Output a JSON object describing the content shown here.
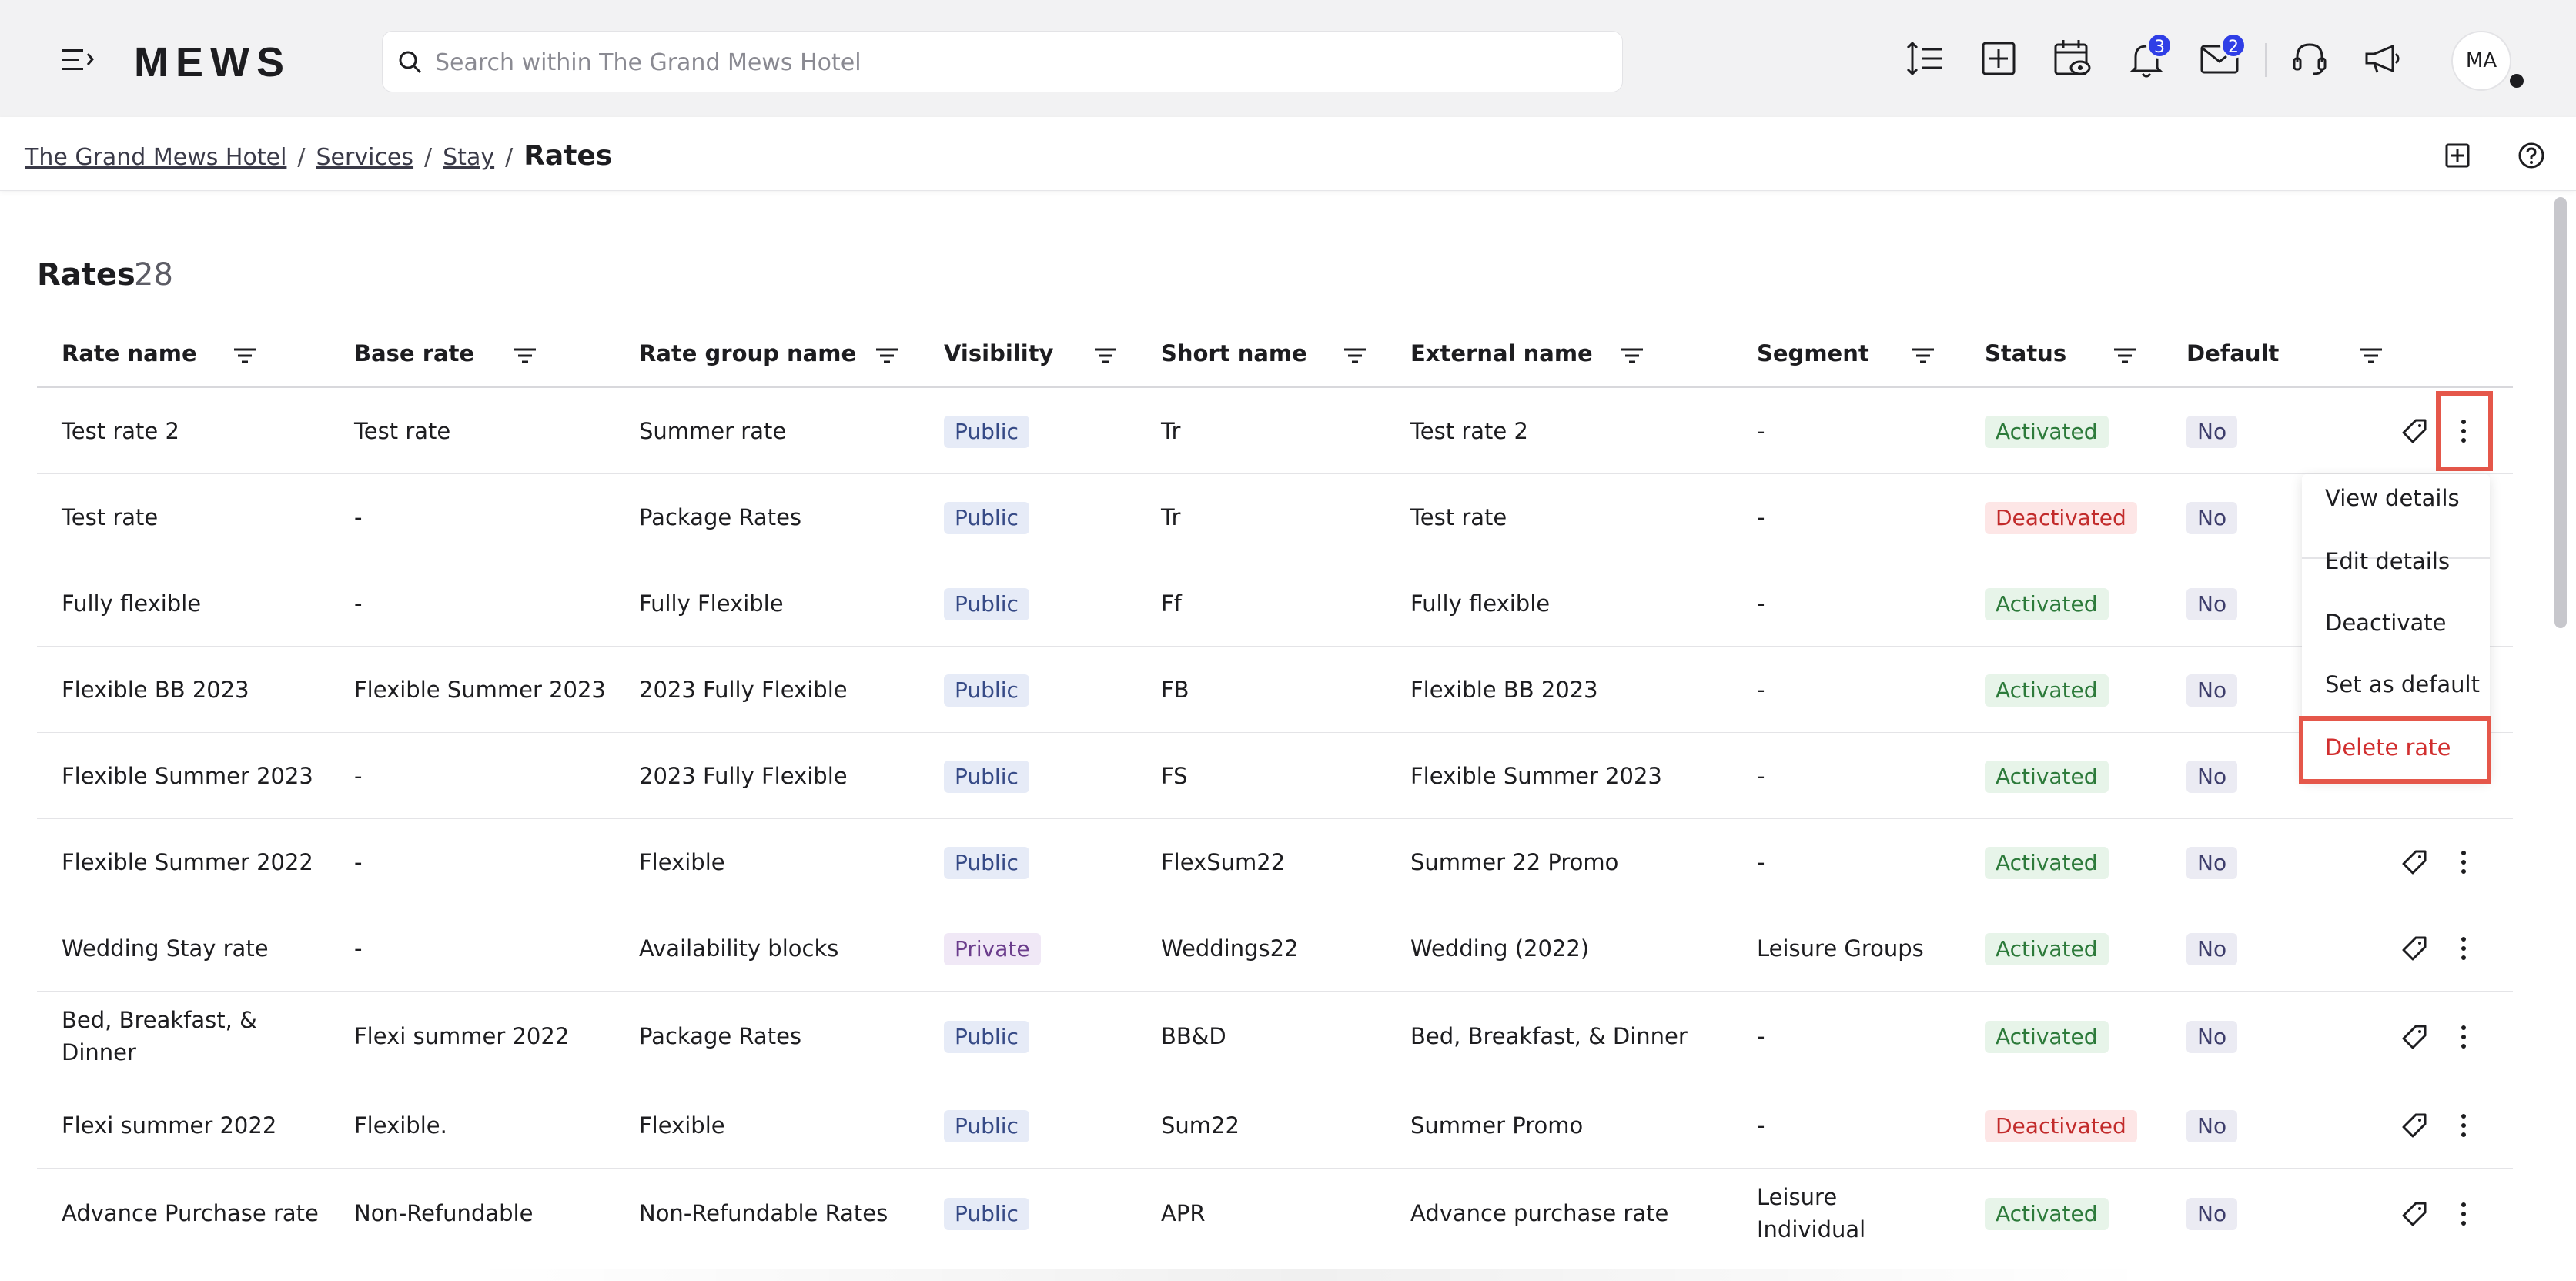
{
  "header": {
    "logo": "MEWS",
    "search_placeholder": "Search within The Grand Mews Hotel",
    "notifications_count": "3",
    "messages_count": "2",
    "avatar_initials": "MA"
  },
  "breadcrumb": {
    "items": [
      "The Grand Mews Hotel",
      "Services",
      "Stay"
    ],
    "separator": "/",
    "current": "Rates"
  },
  "page": {
    "title": "Rates",
    "count": "28"
  },
  "table": {
    "columns": [
      "Rate name",
      "Base rate",
      "Rate group name",
      "Visibility",
      "Short name",
      "External name",
      "Segment",
      "Status",
      "Default"
    ],
    "rows": [
      {
        "name": "Test rate 2",
        "base": "Test rate",
        "group": "Summer rate",
        "visibility": "Public",
        "short": "Tr",
        "external": "Test rate 2",
        "segment": "-",
        "status": "Activated",
        "default": "No"
      },
      {
        "name": "Test rate",
        "base": "-",
        "group": "Package Rates",
        "visibility": "Public",
        "short": "Tr",
        "external": "Test rate",
        "segment": "-",
        "status": "Deactivated",
        "default": "No"
      },
      {
        "name": "Fully flexible",
        "base": "-",
        "group": "Fully Flexible",
        "visibility": "Public",
        "short": "Ff",
        "external": "Fully flexible",
        "segment": "-",
        "status": "Activated",
        "default": "No"
      },
      {
        "name": "Flexible BB 2023",
        "base": "Flexible Summer 2023",
        "group": "2023 Fully Flexible",
        "visibility": "Public",
        "short": "FB",
        "external": "Flexible BB 2023",
        "segment": "-",
        "status": "Activated",
        "default": "No"
      },
      {
        "name": "Flexible Summer 2023",
        "base": "-",
        "group": "2023 Fully Flexible",
        "visibility": "Public",
        "short": "FS",
        "external": "Flexible Summer 2023",
        "segment": "-",
        "status": "Activated",
        "default": "No"
      },
      {
        "name": "Flexible Summer 2022",
        "base": "-",
        "group": "Flexible",
        "visibility": "Public",
        "short": "FlexSum22",
        "external": "Summer 22 Promo",
        "segment": "-",
        "status": "Activated",
        "default": "No"
      },
      {
        "name": "Wedding Stay rate",
        "base": "-",
        "group": "Availability blocks",
        "visibility": "Private",
        "short": "Weddings22",
        "external": "Wedding (2022)",
        "segment": "Leisure Groups",
        "status": "Activated",
        "default": "No"
      },
      {
        "name": "Bed, Breakfast, & Dinner",
        "base": "Flexi summer 2022",
        "group": "Package Rates",
        "visibility": "Public",
        "short": "BB&D",
        "external": "Bed, Breakfast, & Dinner",
        "segment": "-",
        "status": "Activated",
        "default": "No"
      },
      {
        "name": "Flexi summer 2022",
        "base": "Flexible.",
        "group": "Flexible",
        "visibility": "Public",
        "short": "Sum22",
        "external": "Summer Promo",
        "segment": "-",
        "status": "Deactivated",
        "default": "No"
      },
      {
        "name": "Advance Purchase rate",
        "base": "Non-Refundable",
        "group": "Non-Refundable Rates",
        "visibility": "Public",
        "short": "APR",
        "external": "Advance purchase rate",
        "segment": "Leisure Individual",
        "status": "Activated",
        "default": "No"
      }
    ]
  },
  "context_menu": {
    "items": [
      "View details",
      "Edit details",
      "Deactivate",
      "Set as default",
      "Delete rate"
    ]
  },
  "colors": {
    "accent_badge": "#2f3ee6",
    "highlight": "#e5574a",
    "activated": "#2c7a3a",
    "deactivated": "#c22b2b"
  }
}
